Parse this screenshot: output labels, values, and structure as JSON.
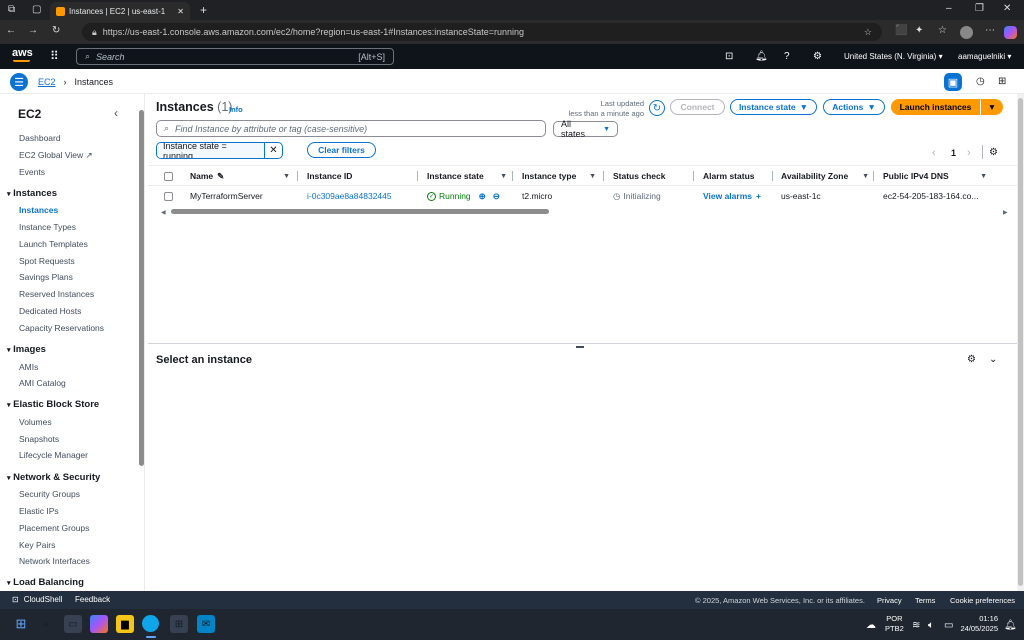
{
  "browser": {
    "tab_title": "Instances | EC2 | us-east-1",
    "url": "https://us-east-1.console.aws.amazon.com/ec2/home?region=us-east-1#Instances:instanceState=running"
  },
  "aws_header": {
    "logo": "aws",
    "search_placeholder": "Search",
    "search_shortcut": "[Alt+S]",
    "region": "United States (N. Virginia)",
    "account": "aamaguelniki"
  },
  "breadcrumb": {
    "root": "EC2",
    "current": "Instances"
  },
  "sidebar": {
    "title": "EC2",
    "top_items": [
      "Dashboard",
      "EC2 Global View",
      "Events"
    ],
    "sections": [
      {
        "title": "Instances",
        "items": [
          "Instances",
          "Instance Types",
          "Launch Templates",
          "Spot Requests",
          "Savings Plans",
          "Reserved Instances",
          "Dedicated Hosts",
          "Capacity Reservations"
        ]
      },
      {
        "title": "Images",
        "items": [
          "AMIs",
          "AMI Catalog"
        ]
      },
      {
        "title": "Elastic Block Store",
        "items": [
          "Volumes",
          "Snapshots",
          "Lifecycle Manager"
        ]
      },
      {
        "title": "Network & Security",
        "items": [
          "Security Groups",
          "Elastic IPs",
          "Placement Groups",
          "Key Pairs",
          "Network Interfaces"
        ]
      },
      {
        "title": "Load Balancing",
        "items": []
      }
    ]
  },
  "main": {
    "title": "Instances",
    "count": "(1)",
    "info": "Info",
    "last_updated_label": "Last updated",
    "last_updated_value": "less than a minute ago",
    "connect": "Connect",
    "instance_state": "Instance state",
    "actions": "Actions",
    "launch": "Launch instances",
    "filter_placeholder": "Find Instance by attribute or tag (case-sensitive)",
    "states_select": "All states",
    "filter_token": "Instance state = running",
    "clear_filters": "Clear filters",
    "page_number": "1",
    "columns": [
      "Name",
      "Instance ID",
      "Instance state",
      "Instance type",
      "Status check",
      "Alarm status",
      "Availability Zone",
      "Public IPv4 DNS"
    ],
    "row": {
      "name": "MyTerraformServer",
      "id": "i-0c309ae8a84832445",
      "state": "Running",
      "type": "t2.micro",
      "status": "Initializing",
      "alarm": "View alarms",
      "az": "us-east-1c",
      "dns": "ec2-54-205-183-164.co..."
    },
    "detail_title": "Select an instance"
  },
  "footer": {
    "cloudshell": "CloudShell",
    "feedback": "Feedback",
    "copyright": "© 2025, Amazon Web Services, Inc. or its affiliates.",
    "privacy": "Privacy",
    "terms": "Terms",
    "cookies": "Cookie preferences"
  },
  "taskbar": {
    "lang1": "POR",
    "lang2": "PTB2",
    "time": "01:16",
    "date": "24/05/2025"
  },
  "colors": {
    "accent": "#0972d3",
    "launch": "#ff9900",
    "running": "#037f0c",
    "nav_bg": "#0f141a"
  }
}
